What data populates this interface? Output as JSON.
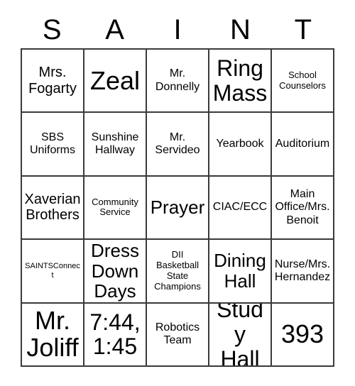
{
  "card": {
    "title_letters": [
      "S",
      "A",
      "I",
      "N",
      "T"
    ],
    "columns": 5,
    "rows": 5,
    "grid_line_color": "#3a3a3a",
    "text_color": "#000000",
    "background_color": "#ffffff",
    "cells": [
      [
        {
          "text": "Mrs.\nFogarty",
          "size": "l"
        },
        {
          "text": "Zeal",
          "size": "xxxl"
        },
        {
          "text": "Mr.\nDonnelly",
          "size": "m"
        },
        {
          "text": "Ring\nMass",
          "size": "xxl"
        },
        {
          "text": "School\nCounselors",
          "size": "s"
        }
      ],
      [
        {
          "text": "SBS\nUniforms",
          "size": "m"
        },
        {
          "text": "Sunshine\nHallway",
          "size": "m"
        },
        {
          "text": "Mr.\nServideo",
          "size": "m"
        },
        {
          "text": "Yearbook",
          "size": "m"
        },
        {
          "text": "Auditorium",
          "size": "m"
        }
      ],
      [
        {
          "text": "Xaverian\nBrothers",
          "size": "l"
        },
        {
          "text": "Community\nService",
          "size": "s"
        },
        {
          "text": "Prayer",
          "size": "xl"
        },
        {
          "text": "CIAC/ECC",
          "size": "m"
        },
        {
          "text": "Main\nOffice/Mrs.\nBenoit",
          "size": "m"
        }
      ],
      [
        {
          "text": "SAINTSConnect",
          "size": "xs"
        },
        {
          "text": "Dress\nDown\nDays",
          "size": "xl"
        },
        {
          "text": "DII\nBasketball\nState\nChampions",
          "size": "s"
        },
        {
          "text": "Dining\nHall",
          "size": "xl"
        },
        {
          "text": "Nurse/Mrs.\nHernandez",
          "size": "m"
        }
      ],
      [
        {
          "text": "Mr.\nJoliff",
          "size": "xxxl"
        },
        {
          "text": "7:44,\n1:45",
          "size": "xxl"
        },
        {
          "text": "Robotics\nTeam",
          "size": "m"
        },
        {
          "text": "Study\nHall",
          "size": "xxl"
        },
        {
          "text": "393",
          "size": "xxxl"
        }
      ]
    ]
  }
}
